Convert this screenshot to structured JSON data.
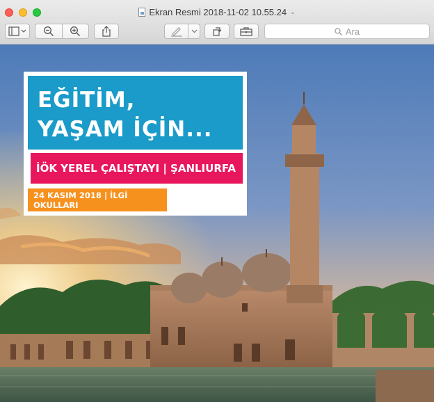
{
  "window": {
    "title": "Ekran Resmi 2018-11-02 10.55.24",
    "title_caret": "⌄"
  },
  "toolbar": {
    "search_placeholder": "Ara"
  },
  "poster": {
    "headline_line1": "EĞİTİM,",
    "headline_line2": "YAŞAM İÇİN...",
    "event": "İÖK YEREL ÇALIŞTAYI | ŞANLIURFA",
    "date": "24 KASIM 2018 | İLGİ OKULLARI"
  },
  "colors": {
    "poster_blue": "#1a9bc9",
    "poster_pink": "#e8175d",
    "poster_orange": "#f7911e"
  }
}
